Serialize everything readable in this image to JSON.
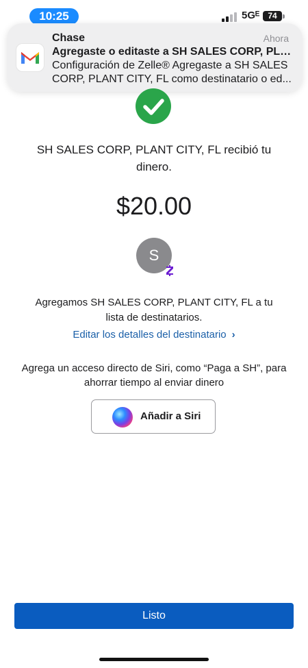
{
  "status_bar": {
    "time": "10:25",
    "network": "5Gᴱ",
    "battery": "74"
  },
  "notification": {
    "app_name": "Chase",
    "time": "Ahora",
    "title": "Agregaste o editaste a SH SALES CORP, PLA...",
    "body": "Configuración de Zelle® Agregaste a SH SALES CORP, PLANT CITY, FL como destinatario o ed...",
    "icon": "gmail-icon"
  },
  "confirmation": {
    "status_icon": "checkmark-icon",
    "received_text": "SH SALES CORP, PLANT CITY, FL recibió tu dinero.",
    "amount": "$20.00",
    "avatar_initial": "S",
    "badge_icon": "zelle-icon",
    "added_text": "Agregamos SH SALES CORP, PLANT CITY, FL a tu lista de destinatarios.",
    "edit_link": "Editar los detalles del destinatario",
    "siri_text": "Agrega un acceso directo de Siri, como “Paga a SH”, para ahorrar tiempo al enviar dinero",
    "siri_button": "Añadir a Siri"
  },
  "footer": {
    "done_button": "Listo"
  },
  "colors": {
    "accent": "#0a5cbf",
    "success": "#2aa54a",
    "link": "#1a5fa8",
    "zelle": "#6b1cd1"
  }
}
